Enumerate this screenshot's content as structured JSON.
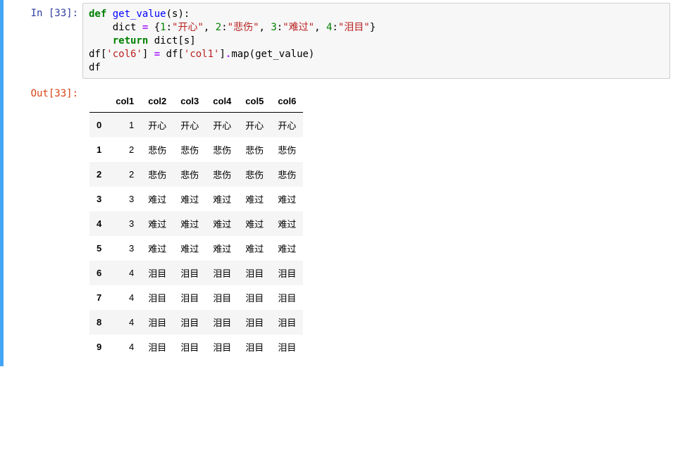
{
  "prompts": {
    "in_label": "In  [33]:",
    "out_label": "Out[33]:"
  },
  "code": {
    "kw_def": "def",
    "fn_name": "get_value",
    "paren_open": "(",
    "param": "s",
    "paren_close_colon": "):",
    "indent1": "    ",
    "dict_assign_left": "dict ",
    "eq": "=",
    "dict_open": " {",
    "n1": "1",
    "colon": ":",
    "s1": "\"开心\"",
    "comma_sp": ", ",
    "n2": "2",
    "s2": "\"悲伤\"",
    "n3": "3",
    "s3": "\"难过\"",
    "n4": "4",
    "s4": "\"泪目\"",
    "dict_close": "}",
    "kw_return": "return",
    "return_expr": " dict[s]",
    "line4_a": "df[",
    "line4_s1": "'col6'",
    "line4_b": "] ",
    "line4_c": " df[",
    "line4_s2": "'col1'",
    "line4_d": "]",
    "dot": ".",
    "map_fn": "map",
    "line4_e": "(get_value)",
    "line5": "df"
  },
  "table": {
    "columns": [
      "col1",
      "col2",
      "col3",
      "col4",
      "col5",
      "col6"
    ],
    "index": [
      "0",
      "1",
      "2",
      "3",
      "4",
      "5",
      "6",
      "7",
      "8",
      "9"
    ],
    "rows": [
      [
        "1",
        "开心",
        "开心",
        "开心",
        "开心",
        "开心"
      ],
      [
        "2",
        "悲伤",
        "悲伤",
        "悲伤",
        "悲伤",
        "悲伤"
      ],
      [
        "2",
        "悲伤",
        "悲伤",
        "悲伤",
        "悲伤",
        "悲伤"
      ],
      [
        "3",
        "难过",
        "难过",
        "难过",
        "难过",
        "难过"
      ],
      [
        "3",
        "难过",
        "难过",
        "难过",
        "难过",
        "难过"
      ],
      [
        "3",
        "难过",
        "难过",
        "难过",
        "难过",
        "难过"
      ],
      [
        "4",
        "泪目",
        "泪目",
        "泪目",
        "泪目",
        "泪目"
      ],
      [
        "4",
        "泪目",
        "泪目",
        "泪目",
        "泪目",
        "泪目"
      ],
      [
        "4",
        "泪目",
        "泪目",
        "泪目",
        "泪目",
        "泪目"
      ],
      [
        "4",
        "泪目",
        "泪目",
        "泪目",
        "泪目",
        "泪目"
      ]
    ]
  }
}
